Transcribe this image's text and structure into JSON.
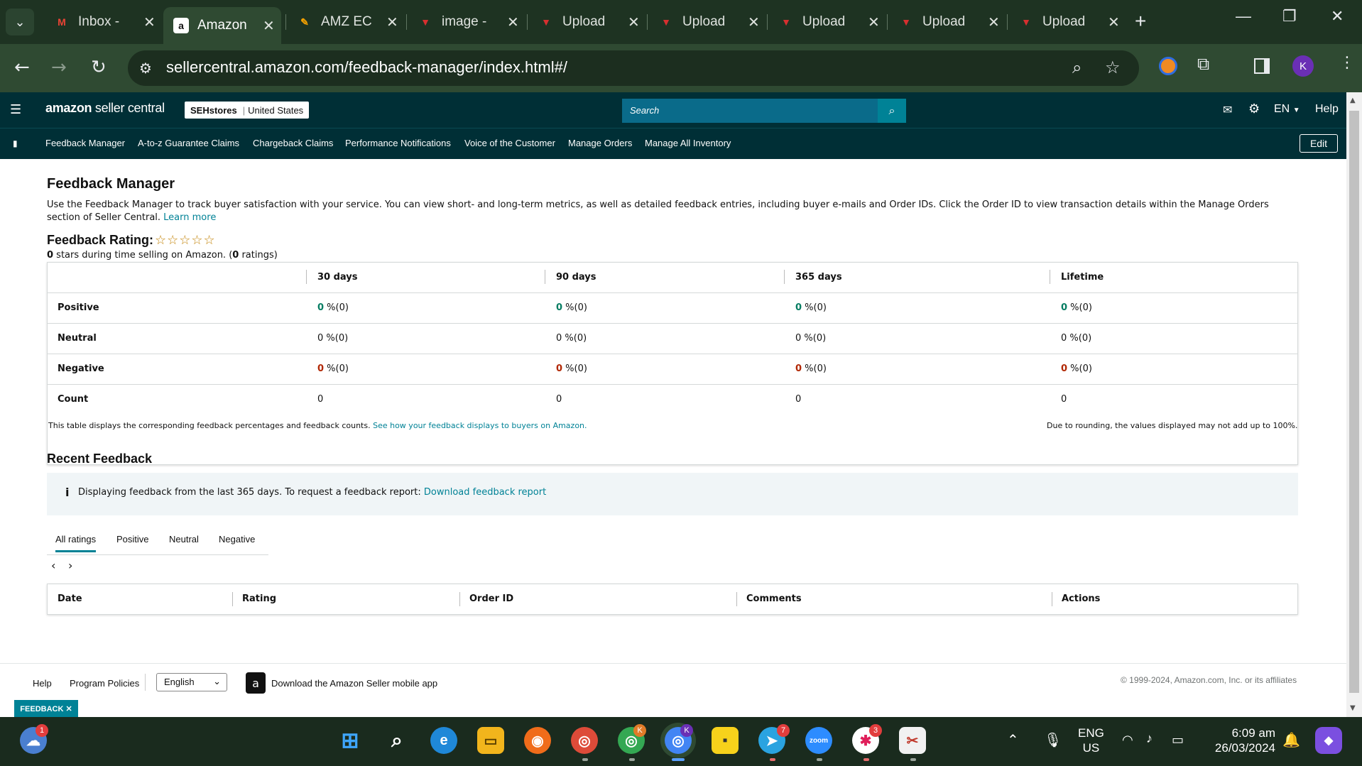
{
  "browser": {
    "tabs": [
      {
        "label": "Inbox -",
        "fav": "M",
        "fav_color": "#ea4335"
      },
      {
        "label": "Amazon",
        "fav": "a",
        "fav_color": "#111111",
        "active": true
      },
      {
        "label": "AMZ EC",
        "fav": "✎",
        "fav_color": "#f4a100"
      },
      {
        "label": "image -",
        "fav": "▼",
        "fav_color": "#d62f2f"
      },
      {
        "label": "Upload",
        "fav": "▼",
        "fav_color": "#d62f2f"
      },
      {
        "label": "Upload",
        "fav": "▼",
        "fav_color": "#d62f2f"
      },
      {
        "label": "Upload",
        "fav": "▼",
        "fav_color": "#d62f2f"
      },
      {
        "label": "Upload",
        "fav": "▼",
        "fav_color": "#d62f2f"
      },
      {
        "label": "Upload",
        "fav": "▼",
        "fav_color": "#d62f2f"
      }
    ],
    "url": "sellercentral.amazon.com/feedback-manager/index.html#/",
    "profile_initial": "K"
  },
  "header": {
    "logo_main": "amazon",
    "logo_sub": "seller central",
    "store_name": "SEHstores",
    "store_region": "United States",
    "search_placeholder": "Search",
    "language": "EN",
    "help": "Help"
  },
  "subnav": {
    "items": [
      "Feedback Manager",
      "A-to-z Guarantee Claims",
      "Chargeback Claims",
      "Performance Notifications",
      "Voice of the Customer",
      "Manage Orders",
      "Manage All Inventory"
    ],
    "edit": "Edit"
  },
  "page": {
    "title": "Feedback Manager",
    "intro_line1": "Use the Feedback Manager to track buyer satisfaction with your service. You can view short- and long-term metrics, as well as detailed feedback entries, including buyer e-mails and Order IDs. Click the Order ID to view transaction details within the Manage Orders",
    "intro_line2": "section of Seller Central.",
    "learn_more": "Learn more",
    "rating_title": "Feedback Rating:",
    "stars_shown": "☆☆☆☆☆",
    "rating_stars_value": "0",
    "rating_sub_mid": " stars during time selling on Amazon. (",
    "rating_count": "0",
    "rating_sub_end": " ratings)"
  },
  "metrics": {
    "columns": [
      "30 days",
      "90 days",
      "365 days",
      "Lifetime"
    ],
    "rows": [
      {
        "label": "Positive",
        "values": [
          "0",
          "0",
          "0",
          "0"
        ],
        "suffix": " %(0)",
        "tone": "green"
      },
      {
        "label": "Neutral",
        "values": [
          "0",
          "0",
          "0",
          "0"
        ],
        "suffix": " %(0)",
        "tone": "plain"
      },
      {
        "label": "Negative",
        "values": [
          "0",
          "0",
          "0",
          "0"
        ],
        "suffix": " %(0)",
        "tone": "red"
      },
      {
        "label": "Count",
        "values": [
          "0",
          "0",
          "0",
          "0"
        ],
        "suffix": "",
        "tone": "count"
      }
    ],
    "note_left": "This table displays the corresponding feedback percentages and feedback counts.",
    "note_link": "See how your feedback displays to buyers on Amazon.",
    "note_right": "Due to rounding, the values displayed may not add up to 100%."
  },
  "recent": {
    "title": "Recent Feedback",
    "info_text": "Displaying feedback from the last 365 days. To request a feedback report:",
    "info_link": "Download feedback report",
    "tabs": [
      "All ratings",
      "Positive",
      "Neutral",
      "Negative"
    ],
    "columns": [
      "Date",
      "Rating",
      "Order ID",
      "Comments",
      "Actions"
    ]
  },
  "footer": {
    "help": "Help",
    "policies": "Program Policies",
    "language": "English",
    "app_text": "Download the Amazon Seller mobile app",
    "copyright": "© 1999-2024, Amazon.com, Inc. or its affiliates",
    "feedback_tag": "FEEDBACK ✕"
  },
  "taskbar": {
    "weather_badge": "1",
    "chrome_k_badge": "K",
    "chrome_active_badge": "K",
    "telegram_badge": "7",
    "slack_badge": "3",
    "zoom_label": "zoom",
    "lang_top": "ENG",
    "lang_bottom": "US",
    "time": "6:09 am",
    "date": "26/03/2024"
  },
  "colors": {
    "header_bg": "#002f36",
    "accent": "#008296",
    "positive": "#067d62",
    "negative": "#b12704"
  }
}
